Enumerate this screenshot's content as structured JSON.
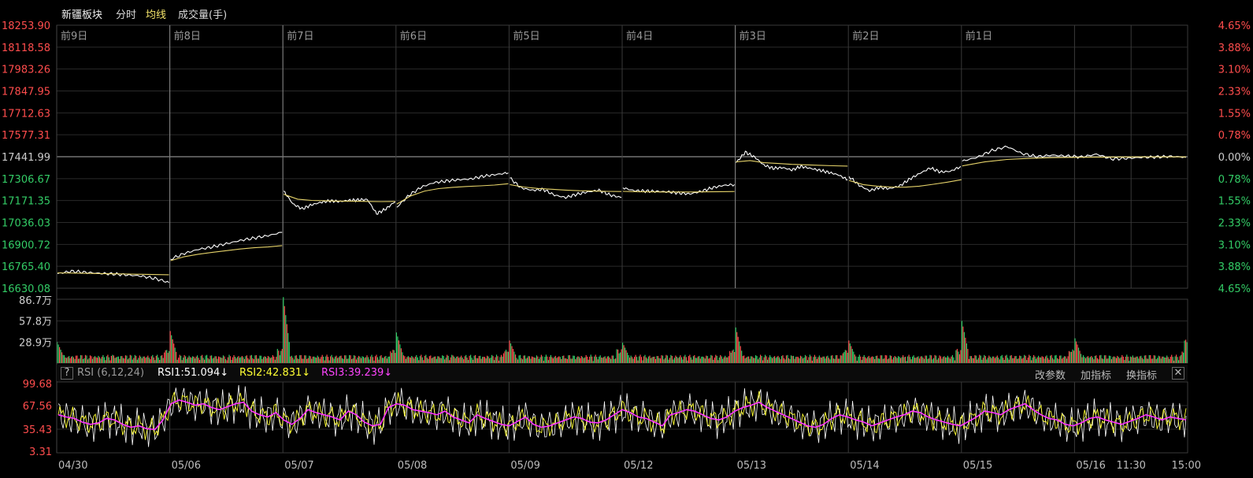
{
  "toolbar": {
    "title": "新疆板块",
    "tab_timeshare": "分时",
    "tab_avg": "均线",
    "tab_volume": "成交量(手)"
  },
  "rsi_bar": {
    "question": "?",
    "name": "RSI (6,12,24)",
    "rsi1": "RSI1:51.094↓",
    "rsi2": "RSI2:42.831↓",
    "rsi3": "RSI3:39.239↓",
    "btn_params": "改参数",
    "btn_add": "加指标",
    "btn_switch": "换指标",
    "btn_close": "✕"
  },
  "colors": {
    "background": "#000000",
    "grid": "#2a2a2a",
    "price_line": "#ffffff",
    "avg_line": "#e6d36a",
    "up": "#ff4d4d",
    "down": "#33cc66",
    "neutral": "#cccccc",
    "rsi1": "#ffffff",
    "rsi2": "#ffff33",
    "rsi3": "#ff33ff"
  },
  "chart_data": [
    {
      "type": "line",
      "panel": "price",
      "day_labels": [
        "前9日",
        "前8日",
        "前7日",
        "前6日",
        "前5日",
        "前4日",
        "前3日",
        "前2日",
        "前1日"
      ],
      "y_left_labels": [
        "18253.90",
        "18118.58",
        "17983.26",
        "17847.95",
        "17712.63",
        "17577.31",
        "17441.99",
        "17306.67",
        "17171.35",
        "17036.03",
        "16900.72",
        "16765.40",
        "16630.08"
      ],
      "y_right_labels": [
        "4.65%",
        "3.88%",
        "3.10%",
        "2.33%",
        "1.55%",
        "0.78%",
        "0.00%",
        "0.78%",
        "1.55%",
        "2.33%",
        "3.10%",
        "3.88%",
        "4.65%"
      ],
      "ylim": [
        16630.08,
        18253.9
      ],
      "reference": 17441.99,
      "days": [
        {
          "price": [
            16720,
            16735,
            16728,
            16722,
            16718,
            16712,
            16705,
            16690,
            16665
          ],
          "avg": [
            16725,
            16722,
            16719,
            16716,
            16713
          ]
        },
        {
          "price": [
            16810,
            16845,
            16870,
            16885,
            16905,
            16925,
            16940,
            16955,
            16975
          ],
          "avg": [
            16800,
            16825,
            16840,
            16852,
            16862,
            16872,
            16880,
            16885,
            16893
          ]
        },
        {
          "price": [
            17230,
            17150,
            17120,
            17145,
            17160,
            17170,
            17165,
            17172,
            17175,
            17178,
            17090,
            17120,
            17165
          ],
          "avg": [
            17210,
            17180,
            17172,
            17170,
            17168,
            17168,
            17166,
            17165,
            17166
          ]
        },
        {
          "price": [
            17130,
            17205,
            17255,
            17282,
            17292,
            17300,
            17305,
            17322,
            17332,
            17342
          ],
          "avg": [
            17150,
            17200,
            17230,
            17245,
            17253,
            17258,
            17262,
            17267,
            17275
          ]
        },
        {
          "price": [
            17310,
            17250,
            17235,
            17240,
            17205,
            17190,
            17210,
            17225,
            17235,
            17205,
            17190
          ],
          "avg": [
            17270,
            17255,
            17246,
            17241,
            17236,
            17232,
            17230,
            17228,
            17227
          ]
        },
        {
          "price": [
            17250,
            17232,
            17230,
            17228,
            17225,
            17218,
            17212,
            17228,
            17250,
            17265,
            17270
          ],
          "avg": [
            17228,
            17226,
            17225,
            17224,
            17224,
            17224,
            17225,
            17226,
            17227
          ]
        },
        {
          "price": [
            17405,
            17470,
            17440,
            17390,
            17370,
            17375,
            17360,
            17382,
            17370,
            17358,
            17345,
            17330,
            17300
          ],
          "avg": [
            17410,
            17418,
            17405,
            17400,
            17395,
            17392,
            17389,
            17386,
            17384
          ]
        },
        {
          "price": [
            17320,
            17265,
            17232,
            17252,
            17245,
            17262,
            17305,
            17340,
            17372,
            17348,
            17352,
            17382
          ],
          "avg": [
            17295,
            17270,
            17260,
            17255,
            17254,
            17260,
            17272,
            17285,
            17300
          ]
        },
        {
          "price": [
            17415,
            17438,
            17480,
            17505,
            17462,
            17442,
            17452,
            17446,
            17440,
            17458,
            17428,
            17432,
            17438,
            17440,
            17444,
            17438
          ],
          "avg": [
            17385,
            17410,
            17425,
            17432,
            17436,
            17438,
            17439,
            17440,
            17441,
            17441,
            17441
          ]
        }
      ]
    },
    {
      "type": "bar",
      "panel": "volume",
      "y_labels": [
        "86.7万",
        "57.8万",
        "28.9万"
      ],
      "ylim": [
        0,
        86.7
      ],
      "unit": "万",
      "day_opening_spikes": [
        25,
        40,
        86.7,
        38,
        27,
        24,
        45,
        27,
        54,
        30,
        28,
        57
      ]
    },
    {
      "type": "line",
      "panel": "rsi",
      "y_labels": [
        "99.68",
        "67.56",
        "35.43",
        "3.31"
      ],
      "ylim": [
        3.31,
        99.68
      ],
      "series": [
        {
          "name": "RSI1",
          "last": 51.094
        },
        {
          "name": "RSI2",
          "last": 42.831
        },
        {
          "name": "RSI3",
          "last": 39.239
        }
      ],
      "rsi3_trend": [
        55,
        52,
        50,
        45,
        42,
        44,
        50,
        48,
        42,
        38,
        40,
        36,
        35,
        48,
        70,
        75,
        72,
        68,
        70,
        65,
        62,
        66,
        70,
        72,
        60,
        55,
        52,
        58,
        48,
        42,
        50,
        62,
        58,
        55,
        52,
        48,
        60,
        55,
        45,
        40,
        42,
        65,
        70,
        68,
        62,
        60,
        58,
        55,
        60,
        52,
        48,
        44,
        55,
        50,
        46,
        42,
        40,
        46,
        52,
        42,
        38,
        40,
        44,
        48,
        52,
        50,
        45,
        44,
        48,
        55,
        62,
        58,
        52,
        50,
        45,
        40,
        55,
        58,
        62,
        60,
        55,
        50,
        48,
        52,
        60,
        65,
        68,
        72,
        65,
        60,
        55,
        50,
        45,
        40,
        38,
        42,
        50,
        55,
        52,
        48,
        45,
        40,
        44,
        48,
        52,
        55,
        60,
        58,
        52,
        48,
        45,
        42,
        40,
        46,
        52,
        60,
        58,
        55,
        62,
        66,
        70,
        62,
        55,
        50,
        48,
        42,
        40,
        44,
        50,
        52,
        48,
        45,
        42,
        46,
        50,
        55,
        52,
        48,
        52,
        50,
        48
      ]
    }
  ],
  "x_axis": {
    "dates": [
      "04/30",
      "05/06",
      "05/07",
      "05/08",
      "05/09",
      "05/12",
      "05/13",
      "05/14",
      "05/15",
      "05/16"
    ],
    "time_mid": "11:30",
    "time_end": "15:00"
  }
}
